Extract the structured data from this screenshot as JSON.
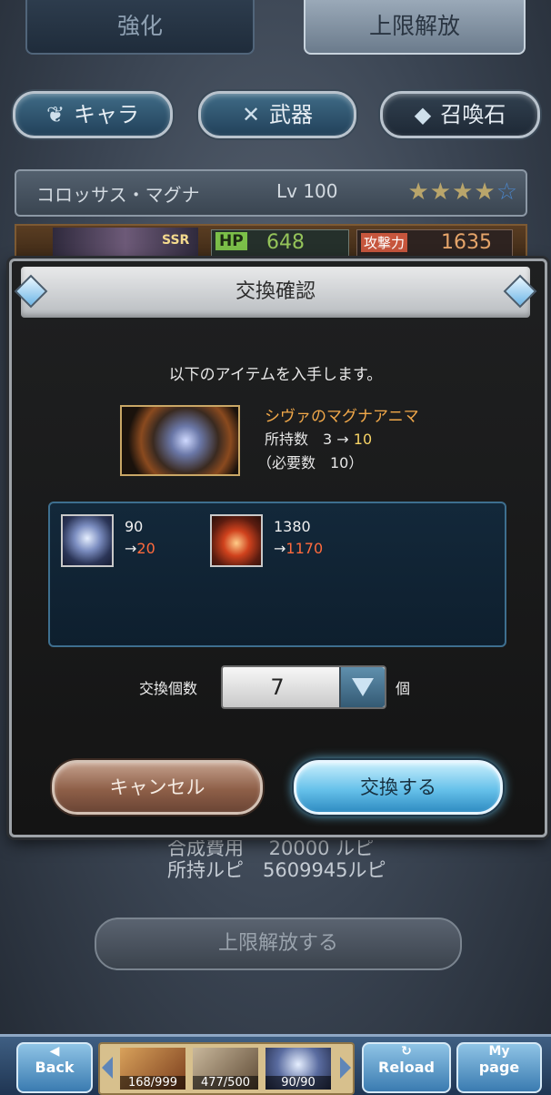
{
  "tabs": [
    {
      "label": "強化"
    },
    {
      "label": "上限解放"
    }
  ],
  "categories": [
    {
      "label": "キャラ",
      "icon": "character-icon"
    },
    {
      "label": "武器",
      "icon": "weapon-icon"
    },
    {
      "label": "召喚石",
      "icon": "summon-stone-icon"
    }
  ],
  "base": {
    "name": "コロッサス・マグナ",
    "level": "Lv 100",
    "rarity": "SSR",
    "hp_label": "HP",
    "hp": "648",
    "atk_label": "攻撃力",
    "atk": "1635",
    "stars": "★★★★"
  },
  "under": {
    "cost_line": "合成費用　 20000 ルピ",
    "rupie_line": "所持ルピ　5609945ルピ",
    "unlock_button": "上限解放する"
  },
  "dialog": {
    "title": "交換確認",
    "message": "以下のアイテムを入手します。",
    "item": {
      "name": "シヴァのマグナアニマ",
      "owned_label": "所持数　3 →",
      "owned_after": "10",
      "required": "（必要数　10）"
    },
    "materials": [
      {
        "before": "90",
        "arrow": "→",
        "after": "20",
        "icon": "anima-orb-icon"
      },
      {
        "before": "1380",
        "arrow": "→",
        "after": "1170",
        "icon": "fire-quartz-icon"
      }
    ],
    "quantity_label": "交換個数",
    "quantity": "7",
    "quantity_unit": "個",
    "cancel": "キャンセル",
    "confirm": "交換する"
  },
  "bottom": {
    "back": "Back",
    "reload": "Reload",
    "mypage_1": "My",
    "mypage_2": "page",
    "slots": [
      {
        "count": "168/999"
      },
      {
        "count": "477/500"
      },
      {
        "count": "90/90"
      }
    ]
  }
}
